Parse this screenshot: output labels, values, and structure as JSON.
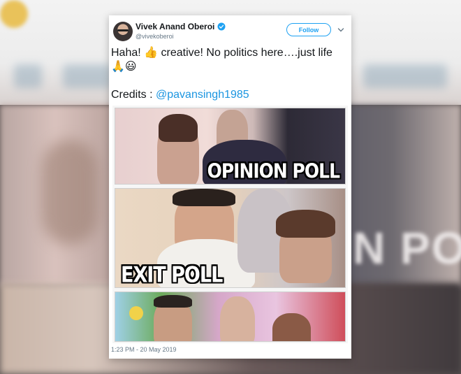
{
  "background": {
    "blurred_caption": "N POLL"
  },
  "tweet": {
    "author_name": "Vivek Anand Oberoi",
    "author_handle": "@vivekoberoi",
    "follow_label": "Follow",
    "text_line1": "Haha! 👍 creative! No politics here….just life",
    "text_line2": "🙏😃",
    "credits_label": "Credits : ",
    "credits_mention": "@pavansingh1985",
    "timestamp": "1:23 PM - 20 May 2019"
  },
  "meme": {
    "panel1_caption": "OPINION POLL",
    "panel2_caption": "EXIT POLL"
  },
  "icons": {
    "verified": "verified-badge-icon",
    "more": "chevron-down-icon"
  },
  "colors": {
    "twitter_blue": "#1da1f2",
    "mention_blue": "#1b95e0",
    "text": "#14171a",
    "muted": "#657786"
  }
}
